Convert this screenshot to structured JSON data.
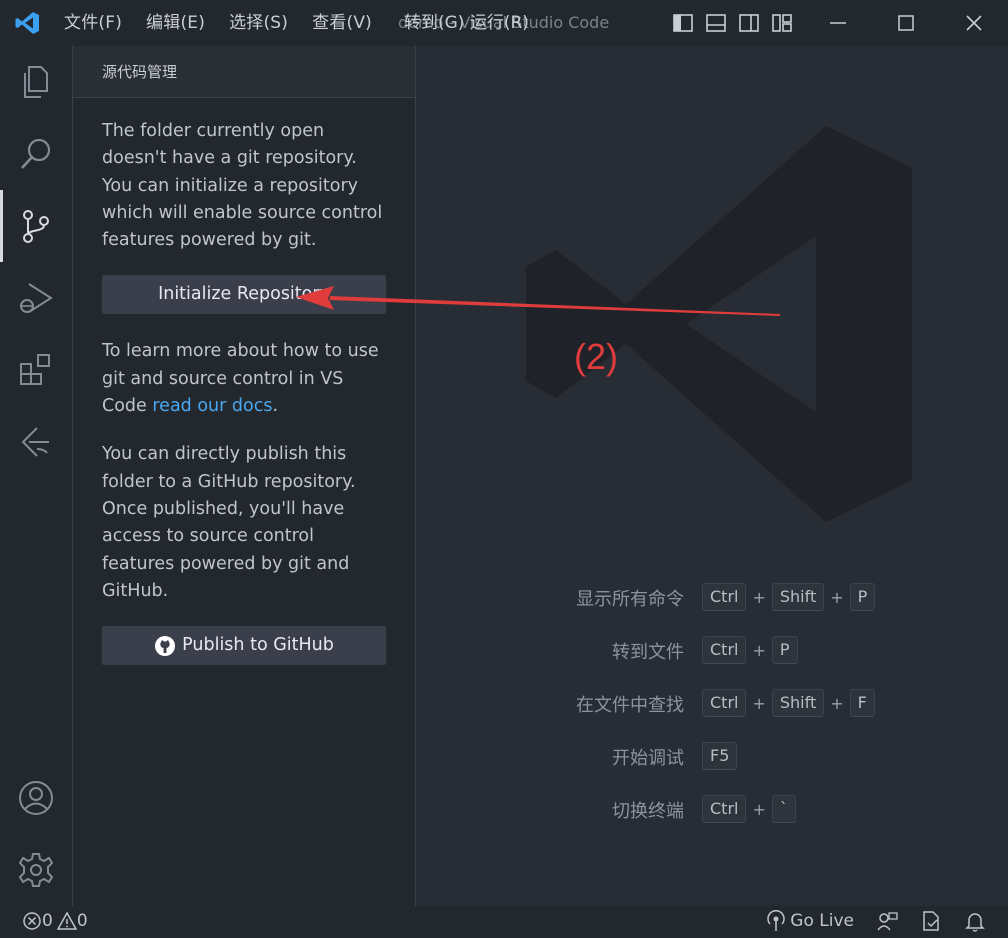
{
  "window": {
    "title": "demo - Visual Studio Code",
    "overlay_menu": "转到(G)  运行(R)",
    "menu": [
      "文件(F)",
      "编辑(E)",
      "选择(S)",
      "查看(V)"
    ]
  },
  "activity_bar": {
    "items": [
      "explorer-icon",
      "search-icon",
      "source-control-icon",
      "run-debug-icon",
      "extensions-icon",
      "remote-explorer-icon"
    ],
    "bottom": [
      "account-icon",
      "settings-gear-icon"
    ]
  },
  "sidebar": {
    "header": "源代码管理",
    "intro": "The folder currently open doesn't have a git repository. You can initialize a repository which will enable source control features powered by git.",
    "init_button": "Initialize Repository",
    "learn_prefix": "To learn more about how to use git and source control in VS Code ",
    "learn_link": "read our docs",
    "learn_suffix": ".",
    "publish_text": "You can directly publish this folder to a GitHub repository. Once published, you'll have access to source control features powered by git and GitHub.",
    "publish_button": "Publish to GitHub"
  },
  "editor": {
    "annotation": "(2)",
    "shortcuts": [
      {
        "label": "显示所有命令",
        "keys": [
          "Ctrl",
          "Shift",
          "P"
        ]
      },
      {
        "label": "转到文件",
        "keys": [
          "Ctrl",
          "P"
        ]
      },
      {
        "label": "在文件中查找",
        "keys": [
          "Ctrl",
          "Shift",
          "F"
        ]
      },
      {
        "label": "开始调试",
        "keys": [
          "F5"
        ]
      },
      {
        "label": "切换终端",
        "keys": [
          "Ctrl",
          "`"
        ]
      }
    ],
    "plus": "+"
  },
  "statusbar": {
    "errors": "0",
    "warnings": "0",
    "go_live": "Go Live"
  },
  "colors": {
    "accent_link": "#4aa8f0",
    "annotation_red": "#e03c3c",
    "button_bg": "#3a3f4b"
  }
}
